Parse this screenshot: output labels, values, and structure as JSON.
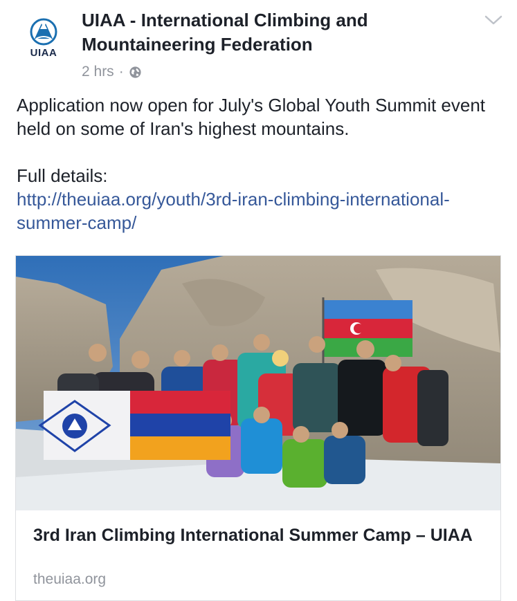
{
  "post": {
    "author": {
      "name": "UIAA - International Climbing and Mountaineering Federation",
      "logo_text": "UIAA",
      "logo_icon": "uiaa-mountain-logo"
    },
    "time": "2 hrs",
    "separator": "·",
    "privacy_icon": "globe-icon",
    "menu_icon": "chevron-down-icon",
    "text_line1": "Application now open for July's Global Youth Summit event held on some of Iran's highest mountains.",
    "text_label": "Full details:",
    "link": "http://theuiaa.org/youth/3rd-iran-climbing-international-summer-camp/"
  },
  "link_card": {
    "image_alt_icon": "group-of-climbers-photo",
    "title": "3rd Iran Climbing International Summer Camp – UIAA",
    "domain": "theuiaa.org"
  },
  "colors": {
    "text": "#1d2129",
    "muted": "#90949c",
    "link": "#365899",
    "brand": "#1a6fb0"
  }
}
